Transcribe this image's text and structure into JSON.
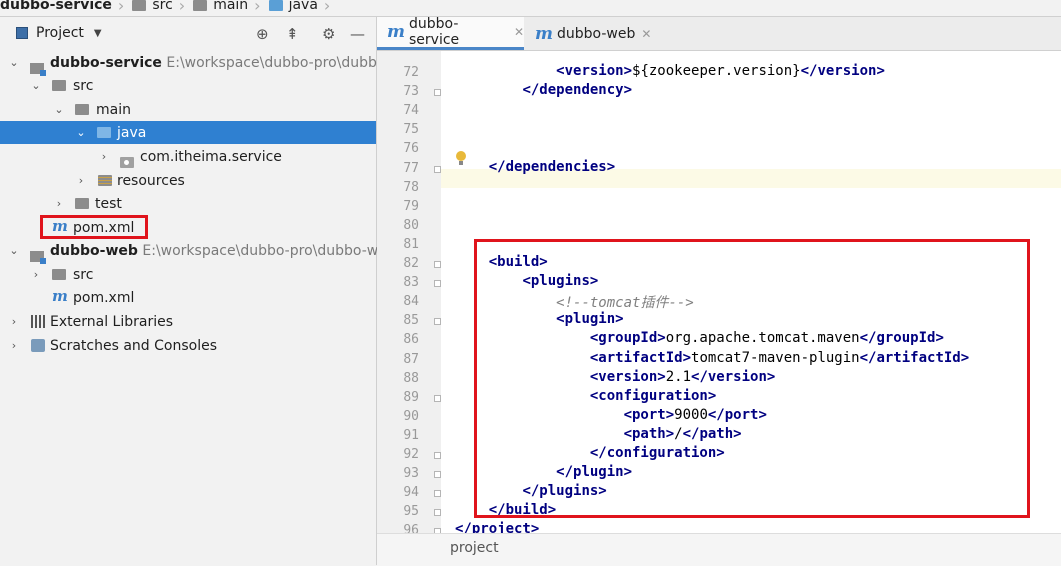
{
  "breadcrumb": [
    "dubbo-service",
    "src",
    "main",
    "java"
  ],
  "project_panel": {
    "title": "Project",
    "tree": [
      {
        "label": "dubbo-service",
        "path": "E:\\workspace\\dubbo-pro\\dubbo-"
      },
      {
        "label": "src"
      },
      {
        "label": "main"
      },
      {
        "label": "java"
      },
      {
        "label": "com.itheima.service"
      },
      {
        "label": "resources"
      },
      {
        "label": "test"
      },
      {
        "label": "pom.xml"
      },
      {
        "label": "dubbo-web",
        "path": "E:\\workspace\\dubbo-pro\\dubbo-we"
      },
      {
        "label": "src"
      },
      {
        "label": "pom.xml"
      },
      {
        "label": "External Libraries"
      },
      {
        "label": "Scratches and Consoles"
      }
    ]
  },
  "tabs": [
    {
      "label": "dubbo-service",
      "active": true
    },
    {
      "label": "dubbo-web",
      "active": false
    }
  ],
  "editor": {
    "line_numbers": [
      "72",
      "73",
      "74",
      "75",
      "76",
      "77",
      "78",
      "79",
      "80",
      "81",
      "82",
      "83",
      "84",
      "85",
      "86",
      "87",
      "88",
      "89",
      "90",
      "91",
      "92",
      "93",
      "94",
      "95",
      "96"
    ],
    "lines": [
      {
        "indent": "            ",
        "open": "version",
        "text": "${zookeeper.version}",
        "close": "version"
      },
      {
        "indent": "        ",
        "close_only": "dependency"
      },
      {},
      {},
      {},
      {
        "indent": "    ",
        "close_only": "dependencies"
      },
      {},
      {},
      {},
      {},
      {
        "indent": "    ",
        "open_only": "build"
      },
      {
        "indent": "        ",
        "open_only": "plugins"
      },
      {
        "indent": "            ",
        "comment": "<!--tomcat插件-->"
      },
      {
        "indent": "            ",
        "open_only": "plugin"
      },
      {
        "indent": "                ",
        "open": "groupId",
        "text": "org.apache.tomcat.maven",
        "close": "groupId"
      },
      {
        "indent": "                ",
        "open": "artifactId",
        "text": "tomcat7-maven-plugin",
        "close": "artifactId"
      },
      {
        "indent": "                ",
        "open": "version",
        "text": "2.1",
        "close": "version"
      },
      {
        "indent": "                ",
        "open_only": "configuration"
      },
      {
        "indent": "                    ",
        "open": "port",
        "text": "9000",
        "close": "port"
      },
      {
        "indent": "                    ",
        "open": "path",
        "text": "/",
        "close": "path"
      },
      {
        "indent": "                ",
        "close_only": "configuration"
      },
      {
        "indent": "            ",
        "close_only": "plugin"
      },
      {
        "indent": "        ",
        "close_only": "plugins"
      },
      {
        "indent": "    ",
        "close_only": "build"
      },
      {
        "indent": "",
        "close_only": "project"
      }
    ],
    "status_breadcrumb": "project"
  },
  "colors": {
    "selection": "#2f80d1",
    "highlight_box": "#e0141c",
    "xml_tag": "#000080"
  }
}
